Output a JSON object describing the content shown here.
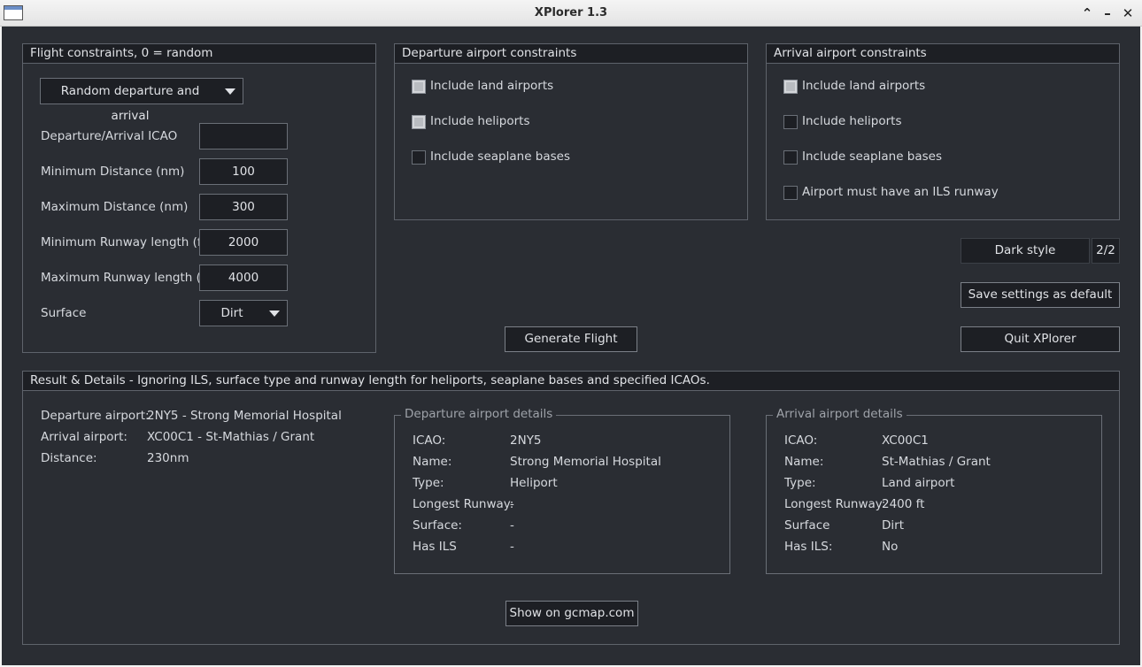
{
  "window": {
    "title": "XPlorer 1.3"
  },
  "flight_constraints": {
    "header": "Flight constraints, 0 = random",
    "mode_dropdown": "Random departure and arrival",
    "fields": [
      {
        "label": "Departure/Arrival ICAO",
        "value": ""
      },
      {
        "label": "Minimum Distance (nm)",
        "value": "100"
      },
      {
        "label": "Maximum Distance (nm)",
        "value": "300"
      },
      {
        "label": "Minimum Runway length (ft)",
        "value": "2000"
      },
      {
        "label": "Maximum Runway length (ft)",
        "value": "4000"
      }
    ],
    "surface_label": "Surface",
    "surface_value": "Dirt"
  },
  "departure_constraints": {
    "header": "Departure airport constraints",
    "options": [
      {
        "label": "Include land airports",
        "checked": true
      },
      {
        "label": "Include heliports",
        "checked": true
      },
      {
        "label": "Include seaplane bases",
        "checked": false
      }
    ]
  },
  "arrival_constraints": {
    "header": "Arrival airport constraints",
    "options": [
      {
        "label": "Include land airports",
        "checked": true
      },
      {
        "label": "Include heliports",
        "checked": false
      },
      {
        "label": "Include seaplane bases",
        "checked": false
      },
      {
        "label": "Airport must have an ILS runway",
        "checked": false
      }
    ]
  },
  "controls": {
    "style_button": "Dark style",
    "style_counter": "2/2",
    "save_button": "Save settings as default",
    "generate_button": "Generate Flight",
    "quit_button": "Quit XPlorer"
  },
  "results": {
    "header": "Result & Details - Ignoring ILS, surface type and runway length for heliports, seaplane bases and specified ICAOs.",
    "summary": [
      {
        "label": "Departure airport:",
        "value": "2NY5 - Strong Memorial Hospital"
      },
      {
        "label": "Arrival airport:",
        "value": "XC00C1 - St-Mathias / Grant"
      },
      {
        "label": "Distance:",
        "value": "230nm"
      }
    ],
    "departure_details": {
      "title": "Departure airport details",
      "rows": [
        {
          "label": "ICAO:",
          "value": "2NY5"
        },
        {
          "label": "Name:",
          "value": "Strong Memorial Hospital"
        },
        {
          "label": "Type:",
          "value": "Heliport"
        },
        {
          "label": "Longest Runway:",
          "value": "-"
        },
        {
          "label": "Surface:",
          "value": "-"
        },
        {
          "label": "Has ILS",
          "value": "-"
        }
      ]
    },
    "arrival_details": {
      "title": "Arrival airport details",
      "rows": [
        {
          "label": "ICAO:",
          "value": "XC00C1"
        },
        {
          "label": "Name:",
          "value": "St-Mathias / Grant"
        },
        {
          "label": "Type:",
          "value": "Land airport"
        },
        {
          "label": "Longest Runway:",
          "value": "2400 ft"
        },
        {
          "label": "Surface",
          "value": "Dirt"
        },
        {
          "label": "Has ILS:",
          "value": "No"
        }
      ]
    },
    "map_button": "Show on gcmap.com"
  }
}
